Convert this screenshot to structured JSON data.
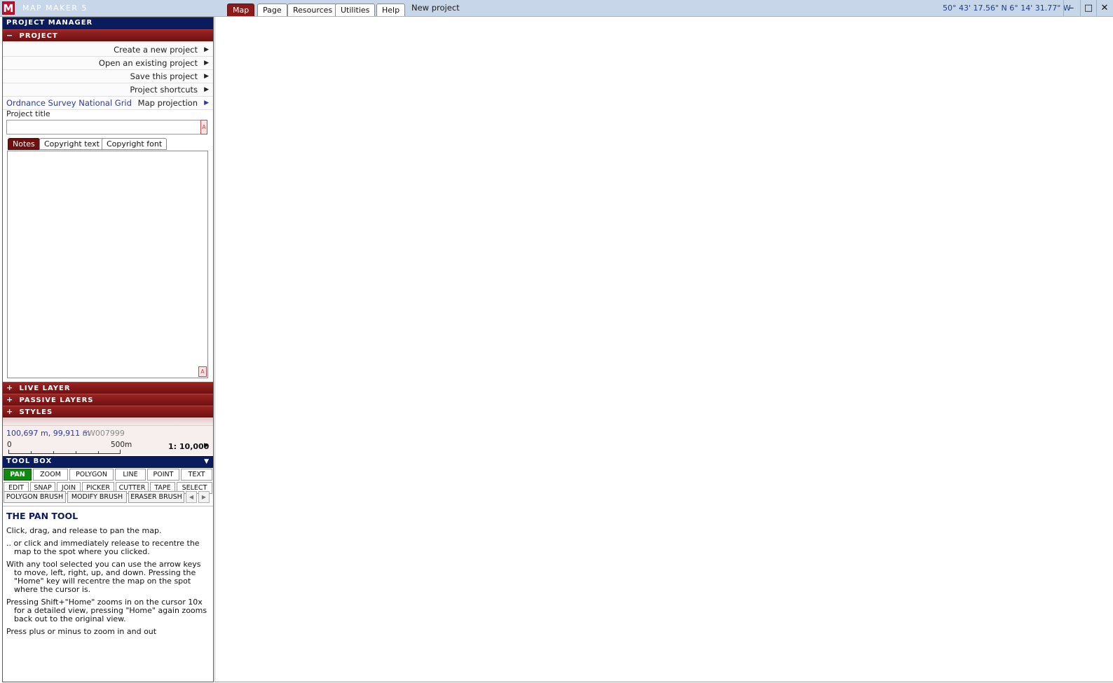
{
  "app": {
    "logo_letter": "M",
    "title": "MAP MAKER 5",
    "document_title": "New project",
    "coordinates": "50° 43' 17.56\" N   6° 14' 31.77\" W"
  },
  "top_tabs": [
    {
      "label": "Map"
    },
    {
      "label": "Page"
    },
    {
      "label": "Resources"
    },
    {
      "label": "Utilities"
    },
    {
      "label": "Help"
    }
  ],
  "window_controls": {
    "minimize": "–",
    "maximize": "□",
    "close": "✕"
  },
  "project_manager": {
    "header": "PROJECT MANAGER",
    "project_section": {
      "toggle": "−",
      "label": "PROJECT"
    },
    "menu": [
      {
        "label": "Create a new project",
        "arrow": "▶"
      },
      {
        "label": "Open an existing project",
        "arrow": "▶"
      },
      {
        "label": "Save this project",
        "arrow": "▶"
      },
      {
        "label": "Project shortcuts",
        "arrow": "▶"
      },
      {
        "label": "Map projection",
        "arrow": "▶",
        "note": "Ordnance Survey National Grid"
      }
    ],
    "project_title_label": "Project title",
    "project_title_value": "",
    "font_button": "A",
    "notes_tabs": [
      {
        "label": "Notes"
      },
      {
        "label": "Copyright text"
      },
      {
        "label": "Copyright font"
      }
    ],
    "notes_value": ""
  },
  "sections": {
    "live_layer": {
      "toggle": "+",
      "label": "LIVE LAYER"
    },
    "passive_layers": {
      "toggle": "+",
      "label": "PASSIVE LAYERS"
    },
    "styles": {
      "toggle": "+",
      "label": "STYLES"
    }
  },
  "status": {
    "grid_coords": "100,697 m, 99,911 m",
    "grid_ref": "SW007999",
    "scale_start": "0",
    "scale_end": "500m",
    "scale_ratio": "1: 10,000",
    "scale_arrow": "▶"
  },
  "toolbox": {
    "header": "TOOL BOX",
    "collapse_icon": "▼",
    "row1": [
      "PAN",
      "ZOOM",
      "POLYGON",
      "LINE",
      "POINT",
      "TEXT"
    ],
    "row2": [
      "EDIT",
      "SNAP",
      "JOIN",
      "PICKER",
      "CUTTER",
      "TAPE",
      "SELECT"
    ],
    "row3": [
      "POLYGON BRUSH",
      "MODIFY BRUSH",
      "ERASER BRUSH"
    ],
    "active_tool": "PAN",
    "nav_prev": "◀",
    "nav_next": "▶"
  },
  "help": {
    "title": "THE PAN TOOL",
    "paragraphs": [
      "Click, drag, and release to pan the map.",
      ".. or click and immediately release to recentre the map to the spot where you clicked.",
      "With any tool selected you can use the arrow keys to move, left, right, up, and down. Pressing the \"Home\" key will recentre the map on the spot where the cursor is.",
      "Pressing Shift+\"Home\" zooms in on the cursor 10x for a detailed view, pressing \"Home\" again zooms back out to the original view.",
      "Press plus or minus to zoom in and out"
    ]
  },
  "colors": {
    "accent_maroon": "#8b1a1a",
    "header_navy": "#0a1c5e",
    "active_tool_green": "#128a12",
    "titlebar_blue": "#c7d6e8"
  }
}
